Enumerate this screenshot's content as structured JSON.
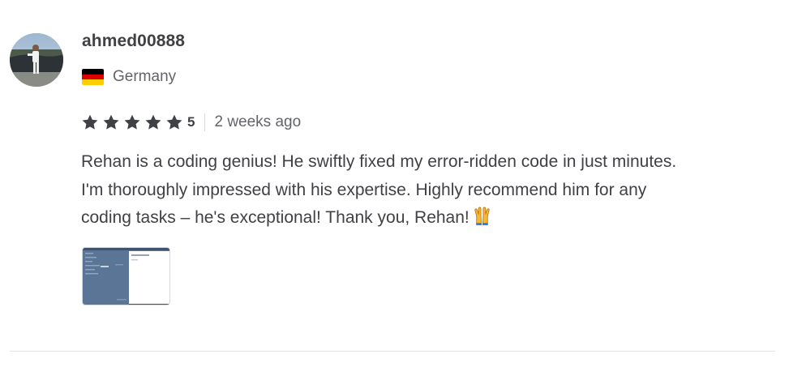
{
  "review": {
    "username": "ahmed00888",
    "country": "Germany",
    "country_flag_icon": "germany-flag-icon",
    "flag_colors": [
      "#000000",
      "#dd0000",
      "#ffce00"
    ],
    "rating": "5",
    "rating_stars_filled": 5,
    "rating_stars_total": 5,
    "time_ago": "2 weeks ago",
    "text_lines": [
      "Rehan is a coding genius! He swiftly fixed my error-ridden code in just minutes.",
      "I'm thoroughly impressed with his expertise. Highly recommend him for any",
      "coding tasks – he's exceptional! Thank you, Rehan!"
    ],
    "text_emoji_icon": "raising-hands-emoji-icon",
    "attachment_icon": "attachment-thumbnail-image"
  },
  "colors": {
    "text_primary": "#404145",
    "text_secondary": "#62646a",
    "star": "#404145",
    "divider": "#e4e5e7"
  }
}
